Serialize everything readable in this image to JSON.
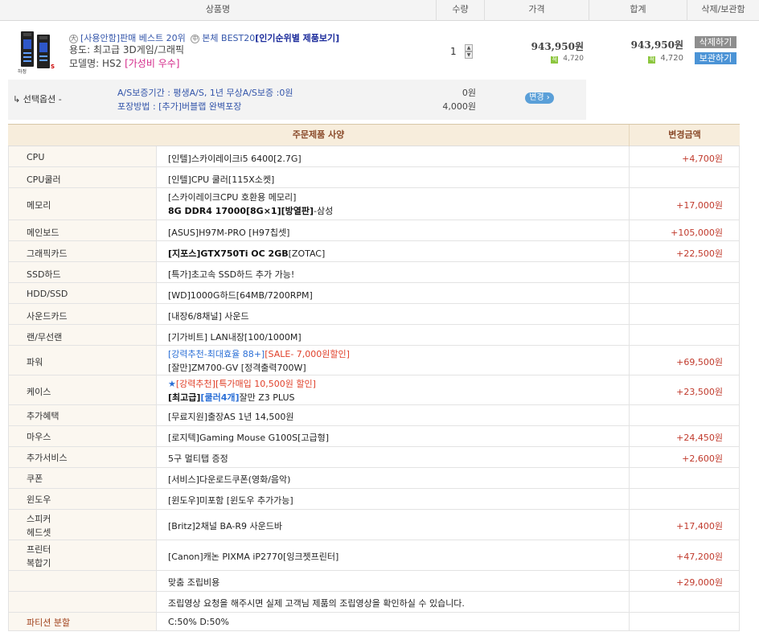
{
  "cart_header": {
    "product": "상품명",
    "qty": "수량",
    "price": "가격",
    "total": "합계",
    "action": "삭제/보관함"
  },
  "product": {
    "thumb_label": "하정",
    "thumb_badge": "S",
    "badge1": "大",
    "title_part1": "[사용안함]판매 베스트 20위",
    "badge2": "中",
    "title_part2": "본체 BEST20",
    "title_best": "[인기순위별 제품보기]",
    "use": "용도: 최고급 3D게임/그래픽",
    "model_prefix": "모델명: HS2 ",
    "model_tag": "[가성비 우수]",
    "qty": "1",
    "price": "943,950원",
    "point_icon": "적",
    "point": "4,720",
    "total": "943,950원",
    "total_point": "4,720",
    "delete_btn": "삭제하기",
    "keep_btn": "보관하기"
  },
  "options": {
    "label": "↳ 선택옵션 -",
    "line1": "A/S보증기간 : 평생A/S, 1년 무상A/S보증 :0원",
    "line2": "포장방법 : [추가]버블랩 완벽포장",
    "price1": "0원",
    "price2": "4,000원",
    "change_btn": "변경 ›"
  },
  "spec": {
    "head_spec": "주문제품 사양",
    "head_price": "변경금액",
    "rows": [
      {
        "cat": "CPU",
        "text": "[인텔]스카이레이크i5 6400[2.7G]",
        "price": "+4,700원"
      },
      {
        "cat": "CPU쿨러",
        "text": "[인텔]CPU 쿨러[115X소켓]",
        "price": ""
      },
      {
        "cat": "메모리",
        "red": "[스카이레이크CPU 호환용 메모리]",
        "text_bold": "8G DDR4 17000[8G×1][방열판]",
        "text_tail": "-삼성",
        "price": "+17,000원"
      },
      {
        "cat": "메인보드",
        "text": "[ASUS]H97M-PRO [H97칩셋]",
        "price": "+105,000원"
      },
      {
        "cat": "그래픽카드",
        "text_bold": "[지포스]GTX750Ti OC 2GB",
        "text_tail": "[ZOTAC]",
        "price": "+22,500원"
      },
      {
        "cat": "SSD하드",
        "text": "[특가]초고속 SSD하드 추가 가능!",
        "price": ""
      },
      {
        "cat": "HDD/SSD",
        "text": "[WD]1000G하드[64MB/7200RPM]",
        "price": ""
      },
      {
        "cat": "사운드카드",
        "text": "[내장6/8채널] 사운드",
        "price": ""
      },
      {
        "cat": "랜/무선랜",
        "text": "[기가비트] LAN내장[100/1000M]",
        "price": ""
      },
      {
        "cat": "파워",
        "blue": "[강력추천-최대효율 88+]",
        "red": "[SALE- 7,000원할인]",
        "text": "[잘만]ZM700-GV [정격출력700W]",
        "price": "+69,500원"
      },
      {
        "cat": "케이스",
        "star": "★",
        "blue": "[강력추천]",
        "red": "[특가매입 10,500원 할인]",
        "text_bold": "[최고급]",
        "text_blue": "[쿨러4개]",
        "text_tail": "잘만 Z3 PLUS",
        "price": "+23,500원"
      },
      {
        "cat": "추가혜택",
        "text": "[무료지원]출장AS 1년 14,500원",
        "price": ""
      },
      {
        "cat": "마우스",
        "text": "[로지텍]Gaming Mouse G100S[고급형]",
        "price": "+24,450원"
      },
      {
        "cat": "추가서비스",
        "text": "5구 멀티탭 증정",
        "price": "+2,600원"
      },
      {
        "cat": "쿠폰",
        "text": "[서비스]다운로드쿠폰(영화/음악)",
        "price": ""
      },
      {
        "cat": "윈도우",
        "text": "[윈도우]미포함 [윈도우 추가가능]",
        "price": ""
      },
      {
        "cat": "스피커",
        "cat2": "헤드셋",
        "text": "[Britz]2채널 BA-R9 사운드바",
        "price": "+17,400원"
      },
      {
        "cat": "프린터",
        "cat2": "복합기",
        "text": "[Canon]캐논 PIXMA iP2770[잉크젯프린터]",
        "price": "+47,200원"
      },
      {
        "cat": "",
        "text": "맞춤 조립비용",
        "price": "+29,000원"
      },
      {
        "cat": "",
        "text": "조립영상 요청을 해주시면 실제 고객님 제품의 조립영상을 확인하실 수 있습니다.",
        "price": ""
      },
      {
        "cat": "파티션 분할",
        "text": "C:50% D:50%",
        "price": ""
      }
    ]
  }
}
